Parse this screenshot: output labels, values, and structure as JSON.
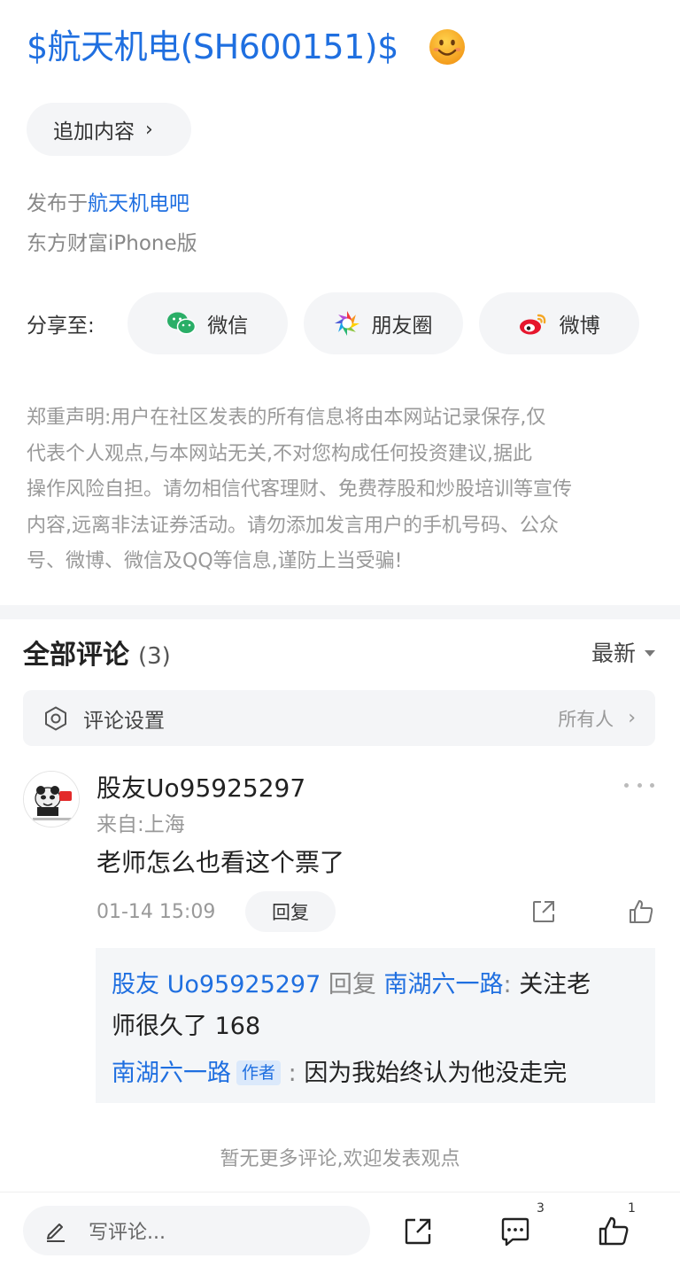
{
  "post": {
    "stock_tag": "$航天机电(SH600151)$",
    "emoji": "smiley-face-icon",
    "append_label": "追加内容",
    "published_prefix": "发布于",
    "board_name": "航天机电吧",
    "client": "东方财富iPhone版"
  },
  "share": {
    "label": "分享至:",
    "targets": [
      {
        "label": "微信",
        "icon": "wechat-icon",
        "color": "#2aae67"
      },
      {
        "label": "朋友圈",
        "icon": "moments-icon"
      },
      {
        "label": "微博",
        "icon": "weibo-icon",
        "color": "#e6162d"
      }
    ]
  },
  "disclaimer": {
    "lines": [
      "郑重声明:用户在社区发表的所有信息将由本网站记录保存,仅",
      "代表个人观点,与本网站无关,不对您构成任何投资建议,据此",
      "操作风险自担。请勿相信代客理财、免费荐股和炒股培训等宣传",
      "内容,远离非法证券活动。请勿添加发言用户的手机号码、公众",
      "号、微博、微信及QQ等信息,谨防上当受骗!"
    ]
  },
  "comments": {
    "title": "全部评论",
    "count": "(3)",
    "sort_label": "最新",
    "settings_label": "评论设置",
    "settings_scope": "所有人",
    "items": [
      {
        "username": "股友Uo95925297",
        "location": "来自:上海",
        "text": "老师怎么也看这个票了",
        "time": "01-14 15:09",
        "reply_label": "回复",
        "replies": [
          {
            "from": "股友 Uo95925297",
            "verb": "回复",
            "to": "南湖六一路",
            "sep": ":",
            "text_1": "关注老",
            "text_2": "师很久了 168"
          },
          {
            "from": "南湖六一路",
            "tag": "作者",
            "sep": ":",
            "text": "因为我始终认为他没走完"
          }
        ]
      }
    ],
    "no_more": "暂无更多评论,欢迎发表观点"
  },
  "bottom_bar": {
    "write_placeholder": "写评论...",
    "comment_count": "3",
    "like_count": "1"
  },
  "colors": {
    "link_blue": "#1f6fe0",
    "muted_gray": "#999999",
    "pill_bg": "#f4f5f7"
  }
}
